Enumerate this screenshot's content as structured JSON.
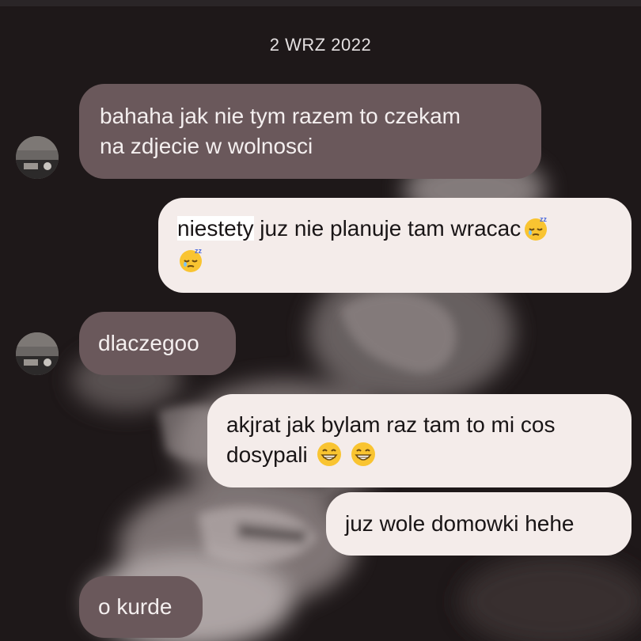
{
  "conversation": {
    "date": "2 WRZ 2022"
  },
  "messages": [
    {
      "direction": "incoming",
      "lines": [
        "bahaha jak nie tym razem to czekam",
        "na zdjecie w wolnosci"
      ]
    },
    {
      "direction": "outgoing",
      "line1_highlight": "niestety",
      "line1_rest": " juz nie planuje tam wracac",
      "emoji": [
        "sleepy-face",
        "sleepy-face"
      ]
    },
    {
      "direction": "incoming",
      "text": "dlaczegoo"
    },
    {
      "direction": "outgoing",
      "lines": [
        "akjrat jak bylam raz tam to mi cos",
        "dosypali"
      ],
      "emoji": [
        "grinning-face",
        "grinning-face"
      ]
    },
    {
      "direction": "outgoing",
      "text": "juz wole domowki hehe"
    },
    {
      "direction": "incoming",
      "text": "o kurde"
    }
  ],
  "colors": {
    "background": "#1e1819",
    "incoming_bubble": "#6a585b",
    "outgoing_bubble": "#f4ecea",
    "incoming_text": "#f4efef",
    "outgoing_text": "#191516"
  }
}
